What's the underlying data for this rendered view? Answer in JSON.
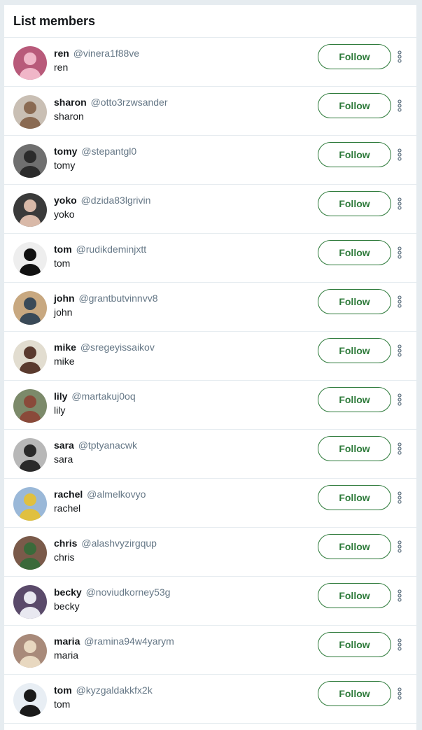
{
  "header": {
    "title": "List members"
  },
  "follow_label": "Follow",
  "colors": {
    "accent": "#2d7a3a",
    "handle": "#657786",
    "divider": "#e6ecf0",
    "page_bg": "#e6ecf0"
  },
  "members": [
    {
      "name": "ren",
      "handle": "@vinera1f88ve",
      "bio": "ren",
      "avatar_bg": "#b85a7a",
      "avatar_fg": "#f0b6c8"
    },
    {
      "name": "sharon",
      "handle": "@otto3rzwsander",
      "bio": "sharon",
      "avatar_bg": "#c9bfb4",
      "avatar_fg": "#8a6a52"
    },
    {
      "name": "tomy",
      "handle": "@stepantgl0",
      "bio": "tomy",
      "avatar_bg": "#6f6f6f",
      "avatar_fg": "#2b2b2b"
    },
    {
      "name": "yoko",
      "handle": "@dzida83lgrivin",
      "bio": "yoko",
      "avatar_bg": "#3a3a3a",
      "avatar_fg": "#d9b9a8"
    },
    {
      "name": "tom",
      "handle": "@rudikdeminjxtt",
      "bio": "tom",
      "avatar_bg": "#eeeeee",
      "avatar_fg": "#111111"
    },
    {
      "name": "john",
      "handle": "@grantbutvinnvv8",
      "bio": "john",
      "avatar_bg": "#c8a880",
      "avatar_fg": "#3a4a58"
    },
    {
      "name": "mike",
      "handle": "@sregeyissaikov",
      "bio": "mike",
      "avatar_bg": "#e2ddd0",
      "avatar_fg": "#5a3a2e"
    },
    {
      "name": "lily",
      "handle": "@martakuj0oq",
      "bio": "lily",
      "avatar_bg": "#7c8a6a",
      "avatar_fg": "#8a4a3a"
    },
    {
      "name": "sara",
      "handle": "@tptyanacwk",
      "bio": "sara",
      "avatar_bg": "#b8b8b8",
      "avatar_fg": "#2a2a2a"
    },
    {
      "name": "rachel",
      "handle": "@almelkovyo",
      "bio": "rachel",
      "avatar_bg": "#9ab8d8",
      "avatar_fg": "#e0c040"
    },
    {
      "name": "chris",
      "handle": "@alashvyzirgqup",
      "bio": "chris",
      "avatar_bg": "#7a5a4a",
      "avatar_fg": "#3a6a3a"
    },
    {
      "name": "becky",
      "handle": "@noviudkorney53g",
      "bio": "becky",
      "avatar_bg": "#5a4a6a",
      "avatar_fg": "#e8e8f0"
    },
    {
      "name": "maria",
      "handle": "@ramina94w4yarym",
      "bio": "maria",
      "avatar_bg": "#a88a7a",
      "avatar_fg": "#e8d8c0"
    },
    {
      "name": "tom",
      "handle": "@kyzgaldakkfx2k",
      "bio": "tom",
      "avatar_bg": "#e8eef4",
      "avatar_fg": "#1a1a1a"
    }
  ]
}
